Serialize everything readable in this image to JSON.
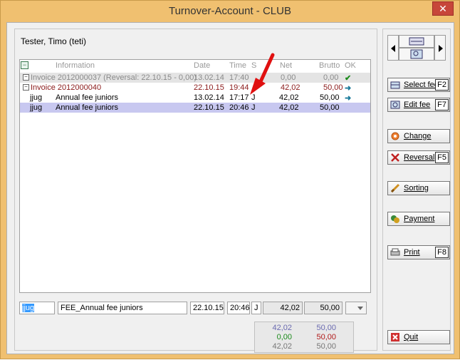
{
  "window": {
    "title": "Turnover-Account - CLUB",
    "close_glyph": "✕"
  },
  "user": {
    "name": "Tester, Timo (teti)"
  },
  "grid": {
    "headers": {
      "info": "Information",
      "date": "Date",
      "time": "Time",
      "s": "S",
      "net": "Net",
      "brutto": "Brutto",
      "ok": "OK"
    },
    "rows": [
      {
        "tree": "−",
        "info": "Invoice 2012000037 (Reversal: 22.10.15 - 0,00)",
        "date": "13.02.14",
        "time": "17:40",
        "s": "",
        "net": "0,00",
        "brutto": "0,00",
        "ok": "✔"
      },
      {
        "tree": "−",
        "info": "Invoice 2012000040",
        "date": "22.10.15",
        "time": "19:44",
        "s": "",
        "net": "42,02",
        "brutto": "50,00",
        "ok": "➜"
      },
      {
        "code": "jjug",
        "info": "Annual fee juniors",
        "date": "13.02.14",
        "time": "17:17",
        "s": "J",
        "net": "42,02",
        "brutto": "50,00",
        "ok": "➜"
      },
      {
        "code": "jjug",
        "info": "Annual fee juniors",
        "date": "22.10.15",
        "time": "20:46",
        "s": "J",
        "net": "42,02",
        "brutto": "50,00",
        "ok": ""
      }
    ]
  },
  "edit": {
    "code": "jjug",
    "description": "FEE_Annual fee juniors",
    "date": "22.10.15",
    "time": "20:46",
    "s": "J",
    "net": "42,02",
    "brutto": "50,00"
  },
  "totals": [
    {
      "net": "42,02",
      "brutto": "50,00",
      "net_color": "#6a6ab0",
      "brutto_color": "#6a6ab0"
    },
    {
      "net": "0,00",
      "brutto": "50,00",
      "net_color": "#1a8a1a",
      "brutto_color": "#b01a1a"
    },
    {
      "net": "42,02",
      "brutto": "50,00",
      "net_color": "#777777",
      "brutto_color": "#777777"
    }
  ],
  "buttons": {
    "select_fee": {
      "label": "Select fee",
      "key": "F2"
    },
    "edit_fee": {
      "label": "Edit fee",
      "key": "F7"
    },
    "change": {
      "label": "Change"
    },
    "reversal": {
      "label": "Reversal",
      "key": "F5"
    },
    "sorting": {
      "label": "Sorting"
    },
    "payment": {
      "label": "Payment"
    },
    "print": {
      "label": "Print",
      "key": "F8"
    },
    "quit": {
      "label": "Quit"
    }
  },
  "colors": {
    "window_frame": "#f0c070",
    "selection": "#c8c8f0",
    "accent_red": "#8b1a1a",
    "annotation_arrow": "#e01010"
  }
}
